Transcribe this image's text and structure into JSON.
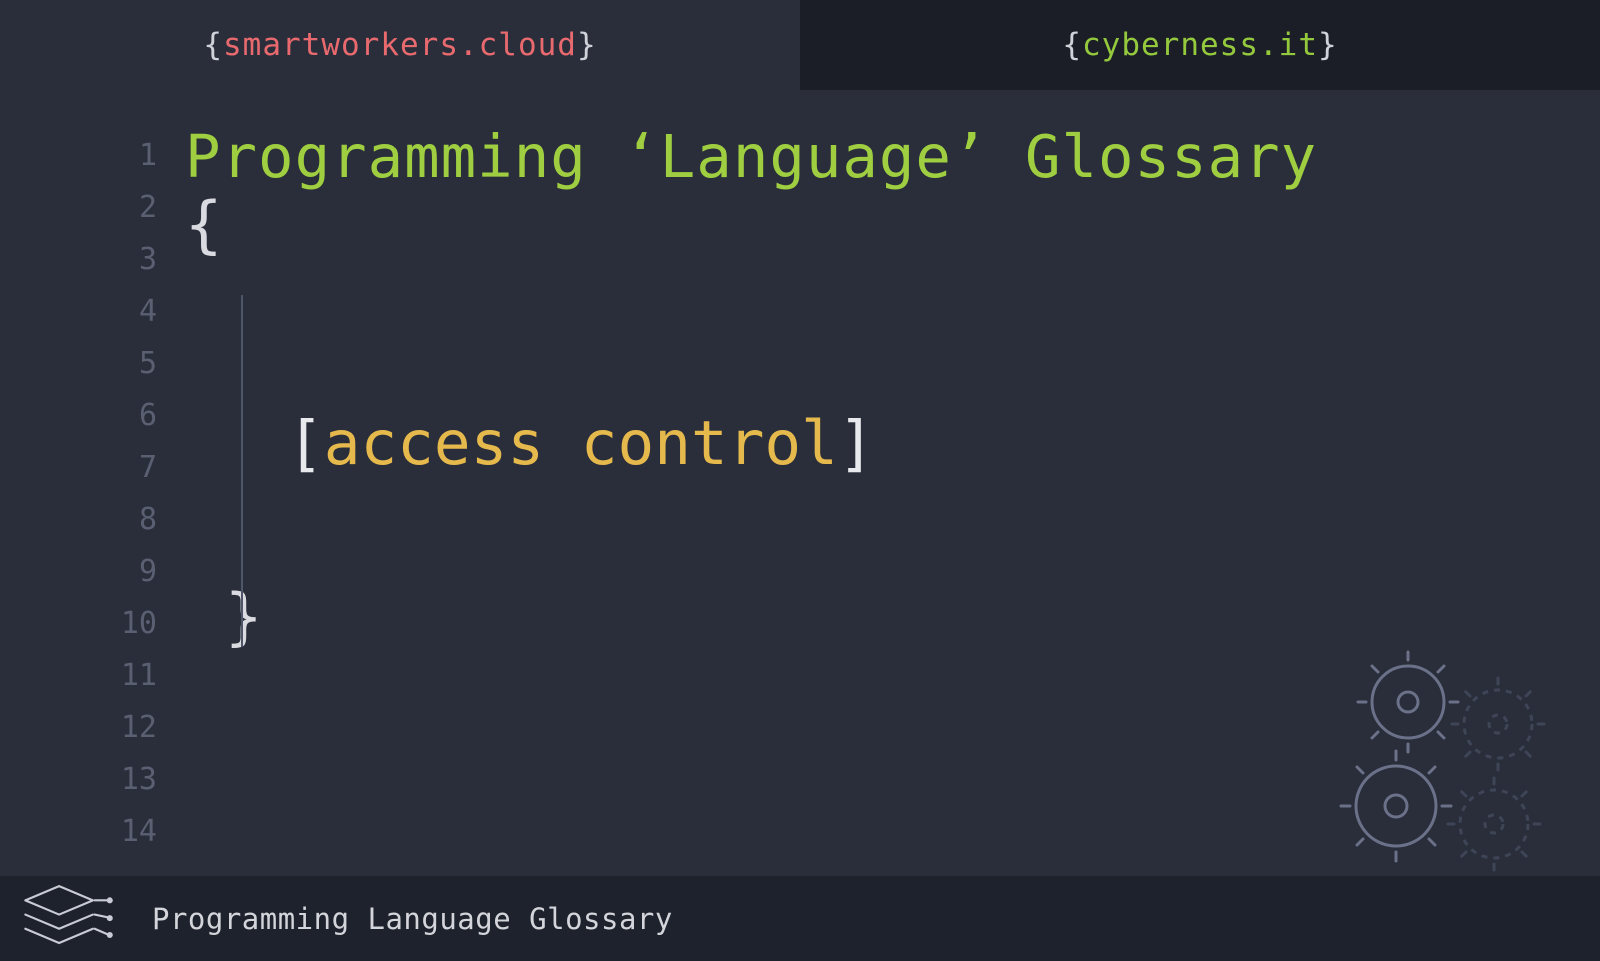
{
  "tabs": {
    "left": {
      "brace_open": "{",
      "domain": "smartworkers.cloud",
      "brace_close": "}"
    },
    "right": {
      "brace_open": "{",
      "domain": "cyberness.it",
      "brace_close": "}"
    }
  },
  "gutter": {
    "lines": [
      "1",
      "2",
      "3",
      "4",
      "5",
      "6",
      "7",
      "8",
      "9",
      "10",
      "11",
      "12",
      "13",
      "14"
    ]
  },
  "code": {
    "title": "Programming ‘Language’ Glossary",
    "brace_open": "{",
    "term_bracket_open": "[",
    "term": "access control",
    "term_bracket_close": "]",
    "brace_close": "}"
  },
  "footer": {
    "label": "Programming Language Glossary"
  }
}
